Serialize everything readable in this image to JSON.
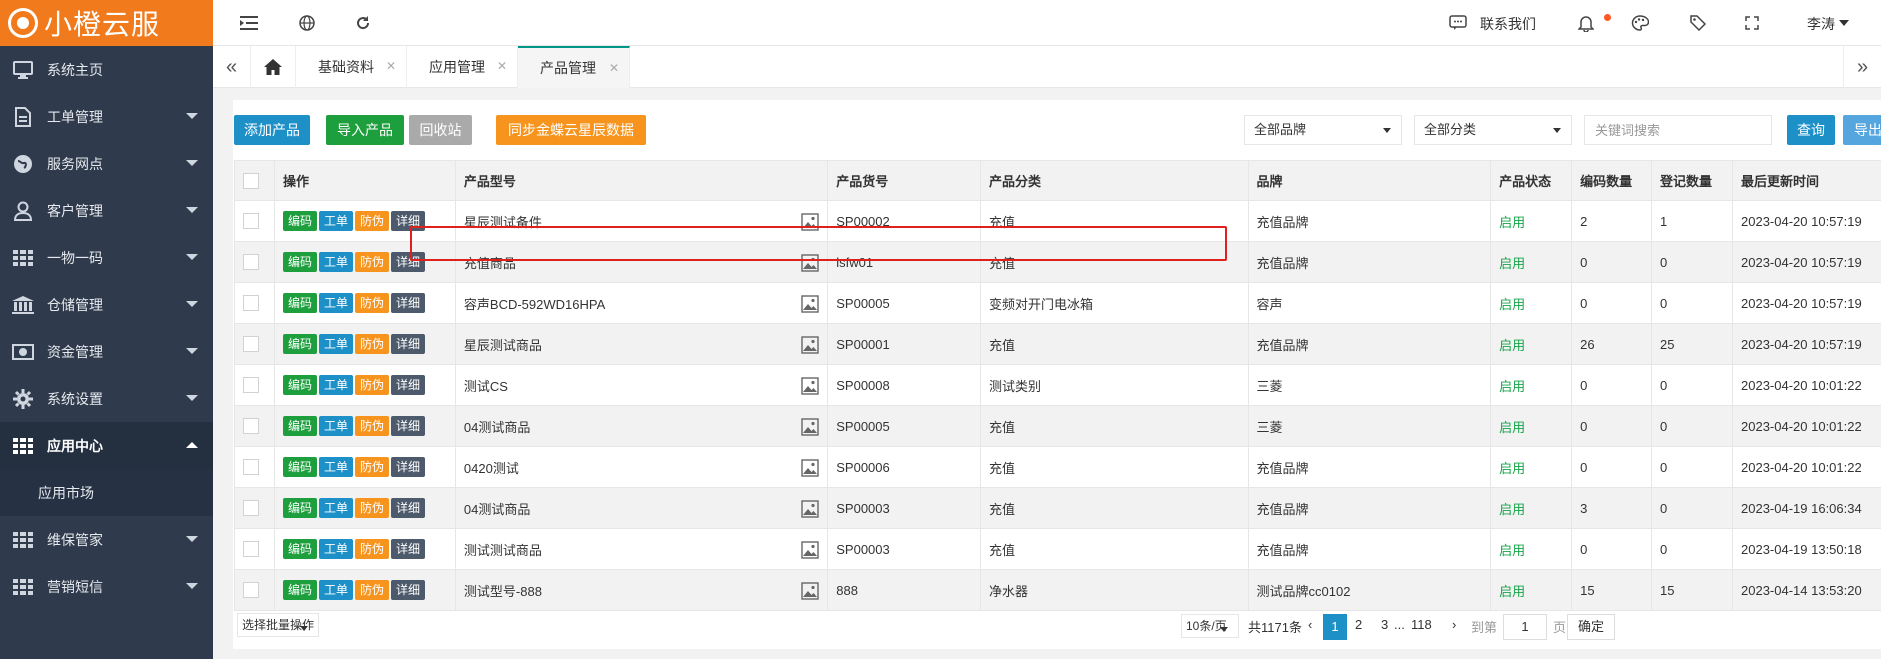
{
  "brand": {
    "name": "小橙云服",
    "color": "#f07a1c"
  },
  "sidebar": {
    "bg": "#2f3b4c",
    "items": [
      {
        "label": "系统主页",
        "icon": "monitor-icon",
        "has_caret": false
      },
      {
        "label": "工单管理",
        "icon": "document-icon",
        "has_caret": true
      },
      {
        "label": "服务网点",
        "icon": "globe-icon",
        "has_caret": true
      },
      {
        "label": "客户管理",
        "icon": "user-icon",
        "has_caret": true
      },
      {
        "label": "一物一码",
        "icon": "grid-icon",
        "has_caret": true
      },
      {
        "label": "仓储管理",
        "icon": "warehouse-icon",
        "has_caret": true
      },
      {
        "label": "资金管理",
        "icon": "money-icon",
        "has_caret": true
      },
      {
        "label": "系统设置",
        "icon": "gear-icon",
        "has_caret": true
      },
      {
        "label": "应用中心",
        "icon": "grid-icon",
        "has_caret": true,
        "expanded": true,
        "sub": [
          {
            "label": "应用市场"
          }
        ]
      },
      {
        "label": "维保管家",
        "icon": "grid-icon",
        "has_caret": true
      },
      {
        "label": "营销短信",
        "icon": "grid-icon",
        "has_caret": true
      }
    ]
  },
  "topbar": {
    "contact": "联系我们",
    "user": "李涛",
    "icons": [
      "menu-toggle-icon",
      "globe-icon",
      "refresh-icon",
      "chat-icon",
      "bell-icon",
      "palette-icon",
      "tag-icon",
      "fullscreen-icon"
    ]
  },
  "tabs": {
    "home_icon": "home-icon",
    "items": [
      {
        "label": "基础资料",
        "active": false
      },
      {
        "label": "应用管理",
        "active": false
      },
      {
        "label": "产品管理",
        "active": true
      }
    ]
  },
  "toolbar": {
    "add": "添加产品",
    "import": "导入产品",
    "recycle": "回收站",
    "sync": "同步金蝶云星辰数据",
    "brand_select": "全部品牌",
    "category_select": "全部分类",
    "search_placeholder": "关键词搜索",
    "query": "查询",
    "export": "导出"
  },
  "table": {
    "headers": [
      "操作",
      "产品型号",
      "产品货号",
      "产品分类",
      "品牌",
      "产品状态",
      "编码数量",
      "登记数量",
      "最后更新时间"
    ],
    "op_labels": [
      "编码",
      "工单",
      "防伪",
      "详细"
    ],
    "rows": [
      {
        "model": "星辰测试备件",
        "sku": "SP00002",
        "category": "充值",
        "brand": "充值品牌",
        "status": "启用",
        "codes": "2",
        "registered": "1",
        "updated": "2023-04-20 10:57:19"
      },
      {
        "model": "充值商品",
        "sku": "lsfw01",
        "category": "充值",
        "brand": "充值品牌",
        "status": "启用",
        "codes": "0",
        "registered": "0",
        "updated": "2023-04-20 10:57:19"
      },
      {
        "model": "容声BCD-592WD16HPA",
        "sku": "SP00005",
        "category": "变频对开门电冰箱",
        "brand": "容声",
        "status": "启用",
        "codes": "0",
        "registered": "0",
        "updated": "2023-04-20 10:57:19"
      },
      {
        "model": "星辰测试商品",
        "sku": "SP00001",
        "category": "充值",
        "brand": "充值品牌",
        "status": "启用",
        "codes": "26",
        "registered": "25",
        "updated": "2023-04-20 10:57:19"
      },
      {
        "model": "测试CS",
        "sku": "SP00008",
        "category": "测试类别",
        "brand": "三菱",
        "status": "启用",
        "codes": "0",
        "registered": "0",
        "updated": "2023-04-20 10:01:22"
      },
      {
        "model": "04测试商品",
        "sku": "SP00005",
        "category": "充值",
        "brand": "三菱",
        "status": "启用",
        "codes": "0",
        "registered": "0",
        "updated": "2023-04-20 10:01:22"
      },
      {
        "model": "0420测试",
        "sku": "SP00006",
        "category": "充值",
        "brand": "充值品牌",
        "status": "启用",
        "codes": "0",
        "registered": "0",
        "updated": "2023-04-20 10:01:22"
      },
      {
        "model": "04测试商品",
        "sku": "SP00003",
        "category": "充值",
        "brand": "充值品牌",
        "status": "启用",
        "codes": "3",
        "registered": "0",
        "updated": "2023-04-19 16:06:34"
      },
      {
        "model": "测试测试商品",
        "sku": "SP00003",
        "category": "充值",
        "brand": "充值品牌",
        "status": "启用",
        "codes": "0",
        "registered": "0",
        "updated": "2023-04-19 13:50:18"
      },
      {
        "model": "测试型号-888",
        "sku": "888",
        "category": "净水器",
        "brand": "测试品牌cc0102",
        "status": "启用",
        "codes": "15",
        "registered": "15",
        "updated": "2023-04-14 13:53:20"
      }
    ]
  },
  "footer": {
    "batch": "选择批量操作",
    "page_size": "10条/页",
    "total": "共1171条",
    "pages": [
      "1",
      "2",
      "3",
      "...",
      "118"
    ],
    "goto_label": "到第",
    "goto_value": "1",
    "page_unit": "页",
    "confirm": "确定"
  }
}
